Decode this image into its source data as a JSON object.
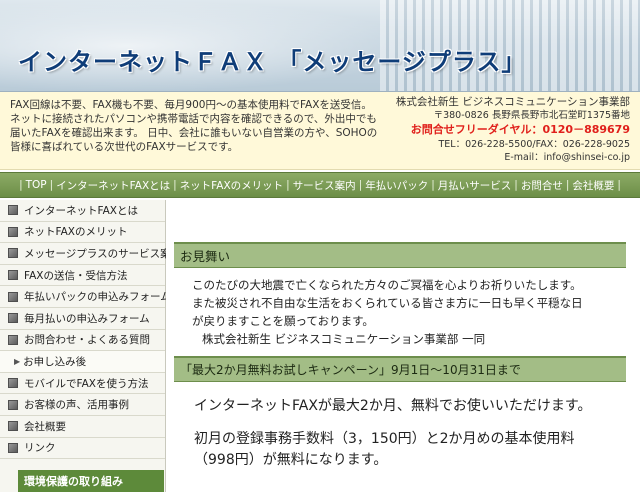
{
  "header": {
    "title": "インターネットＦＡＸ 「メッセージプラス」"
  },
  "info": {
    "description": "FAX回線は不要、FAX機も不要、毎月900円～の基本使用料でFAXを送受信。ネットに接続されたパソコンや携帯電話で内容を確認できるので、外出中でも届いたFAXを確認出来ます。 日中、会社に誰もいない自営業の方や、SOHOの皆様に喜ばれている次世代のFAXサービスです。",
    "company_name": "株式会社新生 ビジネスコミュニケーション事業部",
    "address": "〒380-0826 長野県長野市北石堂町1375番地",
    "freedial": "お問合せフリーダイヤル：0120－889679",
    "tel_fax": "TEL：026-228-5500/FAX：026-228-9025",
    "email": "E-mail：info@shinsei-co.jp"
  },
  "nav": {
    "items": [
      "TOP",
      "インターネットFAXとは",
      "ネットFAXのメリット",
      "サービス案内",
      "年払いパック",
      "月払いサービス",
      "お問合せ",
      "会社概要"
    ]
  },
  "sidebar": {
    "items": [
      {
        "label": "インターネットFAXとは",
        "sub": false
      },
      {
        "label": "ネットFAXのメリット",
        "sub": false
      },
      {
        "label": "メッセージプラスのサービス案内",
        "sub": false
      },
      {
        "label": "FAXの送信・受信方法",
        "sub": false
      },
      {
        "label": "年払いパックの申込みフォーム",
        "sub": false
      },
      {
        "label": "毎月払いの申込みフォーム",
        "sub": false
      },
      {
        "label": "お問合わせ・よくある質問",
        "sub": false
      },
      {
        "label": "お申し込み後",
        "sub": true
      },
      {
        "label": "モバイルでFAXを使う方法",
        "sub": false
      },
      {
        "label": "お客様の声、活用事例",
        "sub": false
      },
      {
        "label": "会社概要",
        "sub": false
      },
      {
        "label": "リンク",
        "sub": false
      }
    ],
    "eco_button": "環境保護の取り組み"
  },
  "main": {
    "heading1": "お見舞い",
    "condolence_lines": [
      "このたびの大地震で亡くなられた方々のご冥福を心よりお祈りいたします。",
      "また被災され不自由な生活をおくられている皆さま方に一日も早く平穏な日",
      "が戻りますことを願っております。"
    ],
    "signature": "株式会社新生 ビジネスコミュニケーション事業部 一同",
    "heading2": "「最大2か月無料お試しキャンペーン」9月1日～10月31日まで",
    "campaign_p1": "インターネットFAXが最大2か月、無料でお使いいただけます。",
    "campaign_p2": "初月の登録事務手数料（3，150円）と2か月めの基本使用料（998円）が無料になります。"
  }
}
